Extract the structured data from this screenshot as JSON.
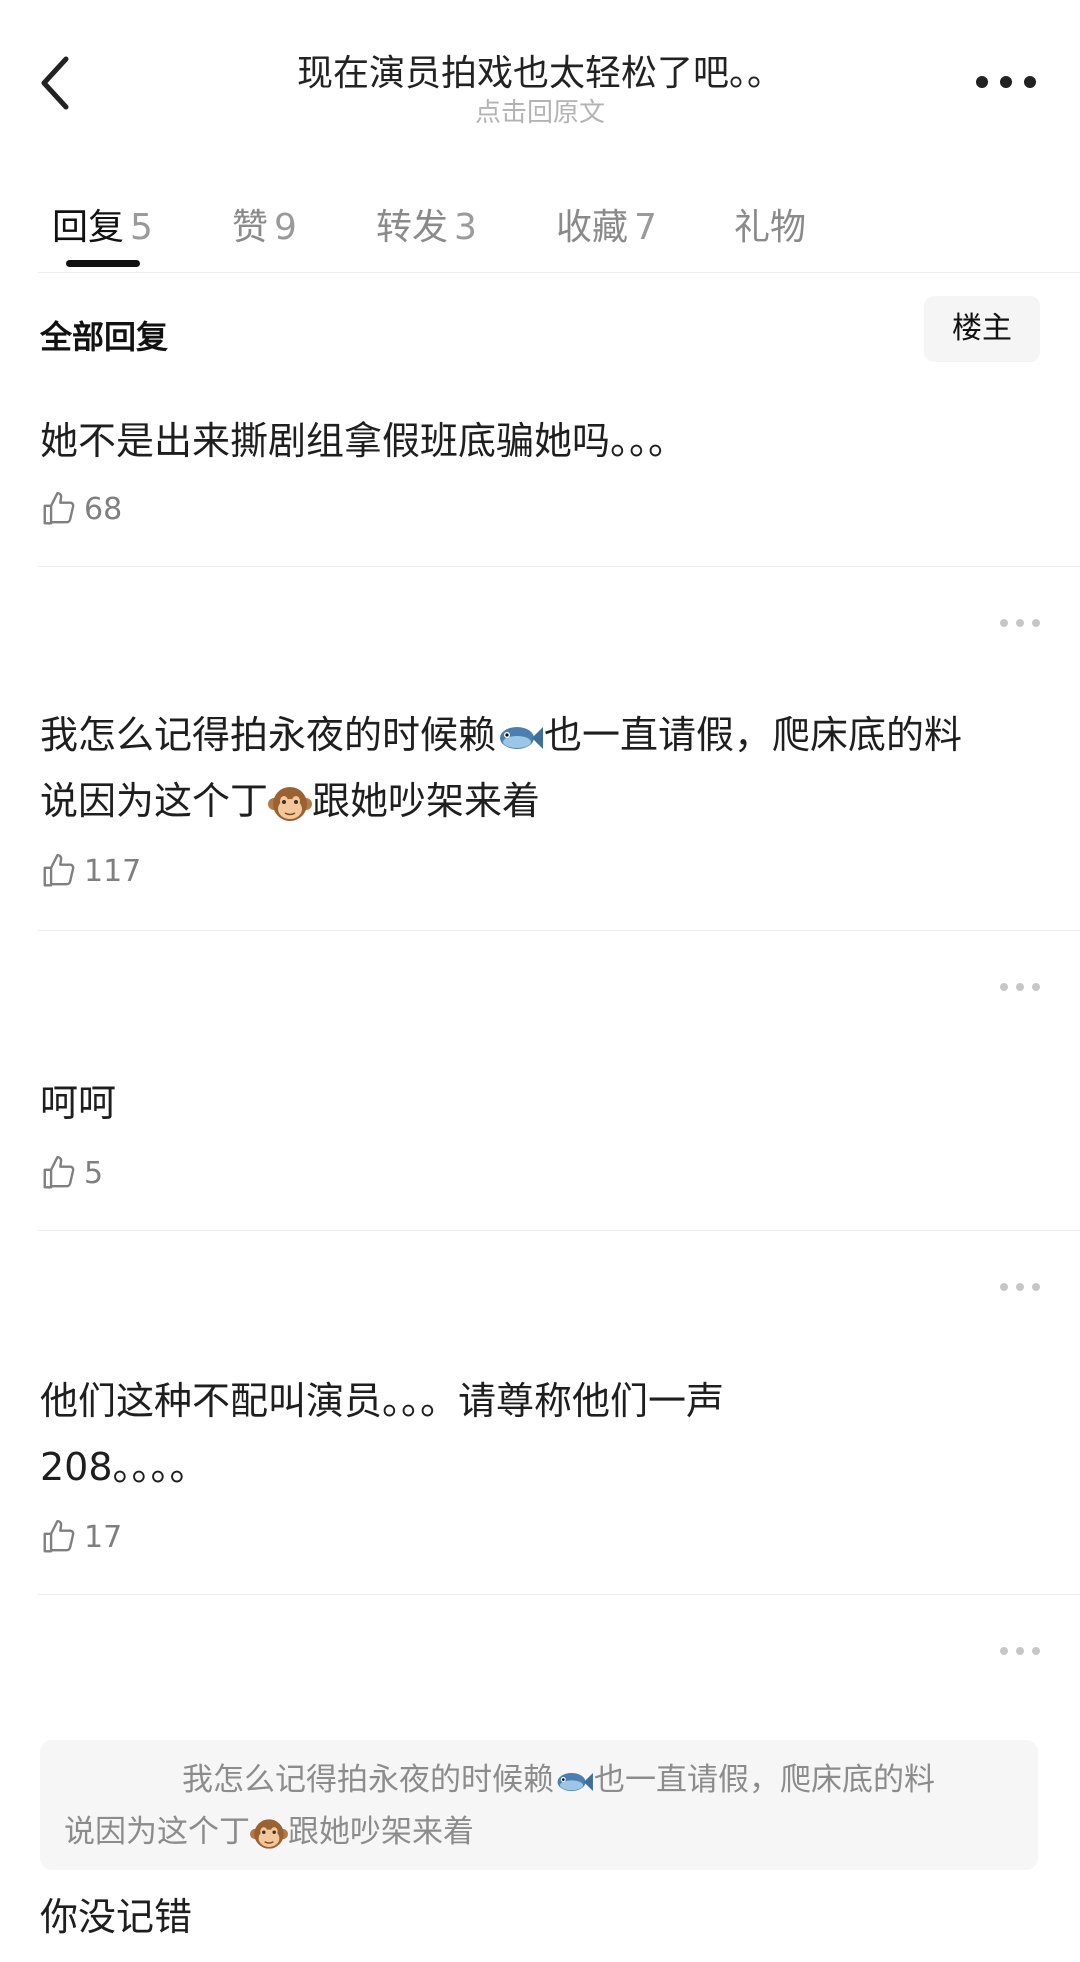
{
  "header": {
    "back_icon": "chevron-left-icon",
    "title": "现在演员拍戏也太轻松了吧。。",
    "subtitle": "点击回原文",
    "more_icon": "more-horizontal-icon"
  },
  "tabs": [
    {
      "label": "回复",
      "count": "5",
      "active": true
    },
    {
      "label": "赞",
      "count": "9",
      "active": false
    },
    {
      "label": "转发",
      "count": "3",
      "active": false
    },
    {
      "label": "收藏",
      "count": "7",
      "active": false
    },
    {
      "label": "礼物",
      "count": "",
      "active": false
    }
  ],
  "filter": {
    "all_label": "全部回复",
    "op_button": "楼主"
  },
  "comments": [
    {
      "text": "她不是出来撕剧组拿假班底骗她吗。。。",
      "likes": "68"
    },
    {
      "text_line1_a": "我怎么记得拍永夜的时候赖",
      "text_line1_b": "也一直请假，爬床底的料",
      "text_line2_a": "说因为这个丁",
      "text_line2_b": "跟她吵架来着",
      "likes": "117"
    },
    {
      "text": "呵呵",
      "likes": "5"
    },
    {
      "text_line1": "他们这种不配叫演员。。。请尊称他们一声",
      "text_line2": "208。。。。",
      "likes": "17"
    },
    {
      "quote_line1_a": "我怎么记得拍永夜的时候赖",
      "quote_line1_b": "也一直请假，爬床底的料",
      "quote_line2_a": "说因为这个丁",
      "quote_line2_b": "跟她吵架来着",
      "text": "你没记错"
    }
  ],
  "icons": {
    "like": "thumbs-up-icon",
    "comment_more": "more-dots-icon",
    "fish": "fish-emoji-icon",
    "monkey": "monkey-emoji-icon"
  }
}
